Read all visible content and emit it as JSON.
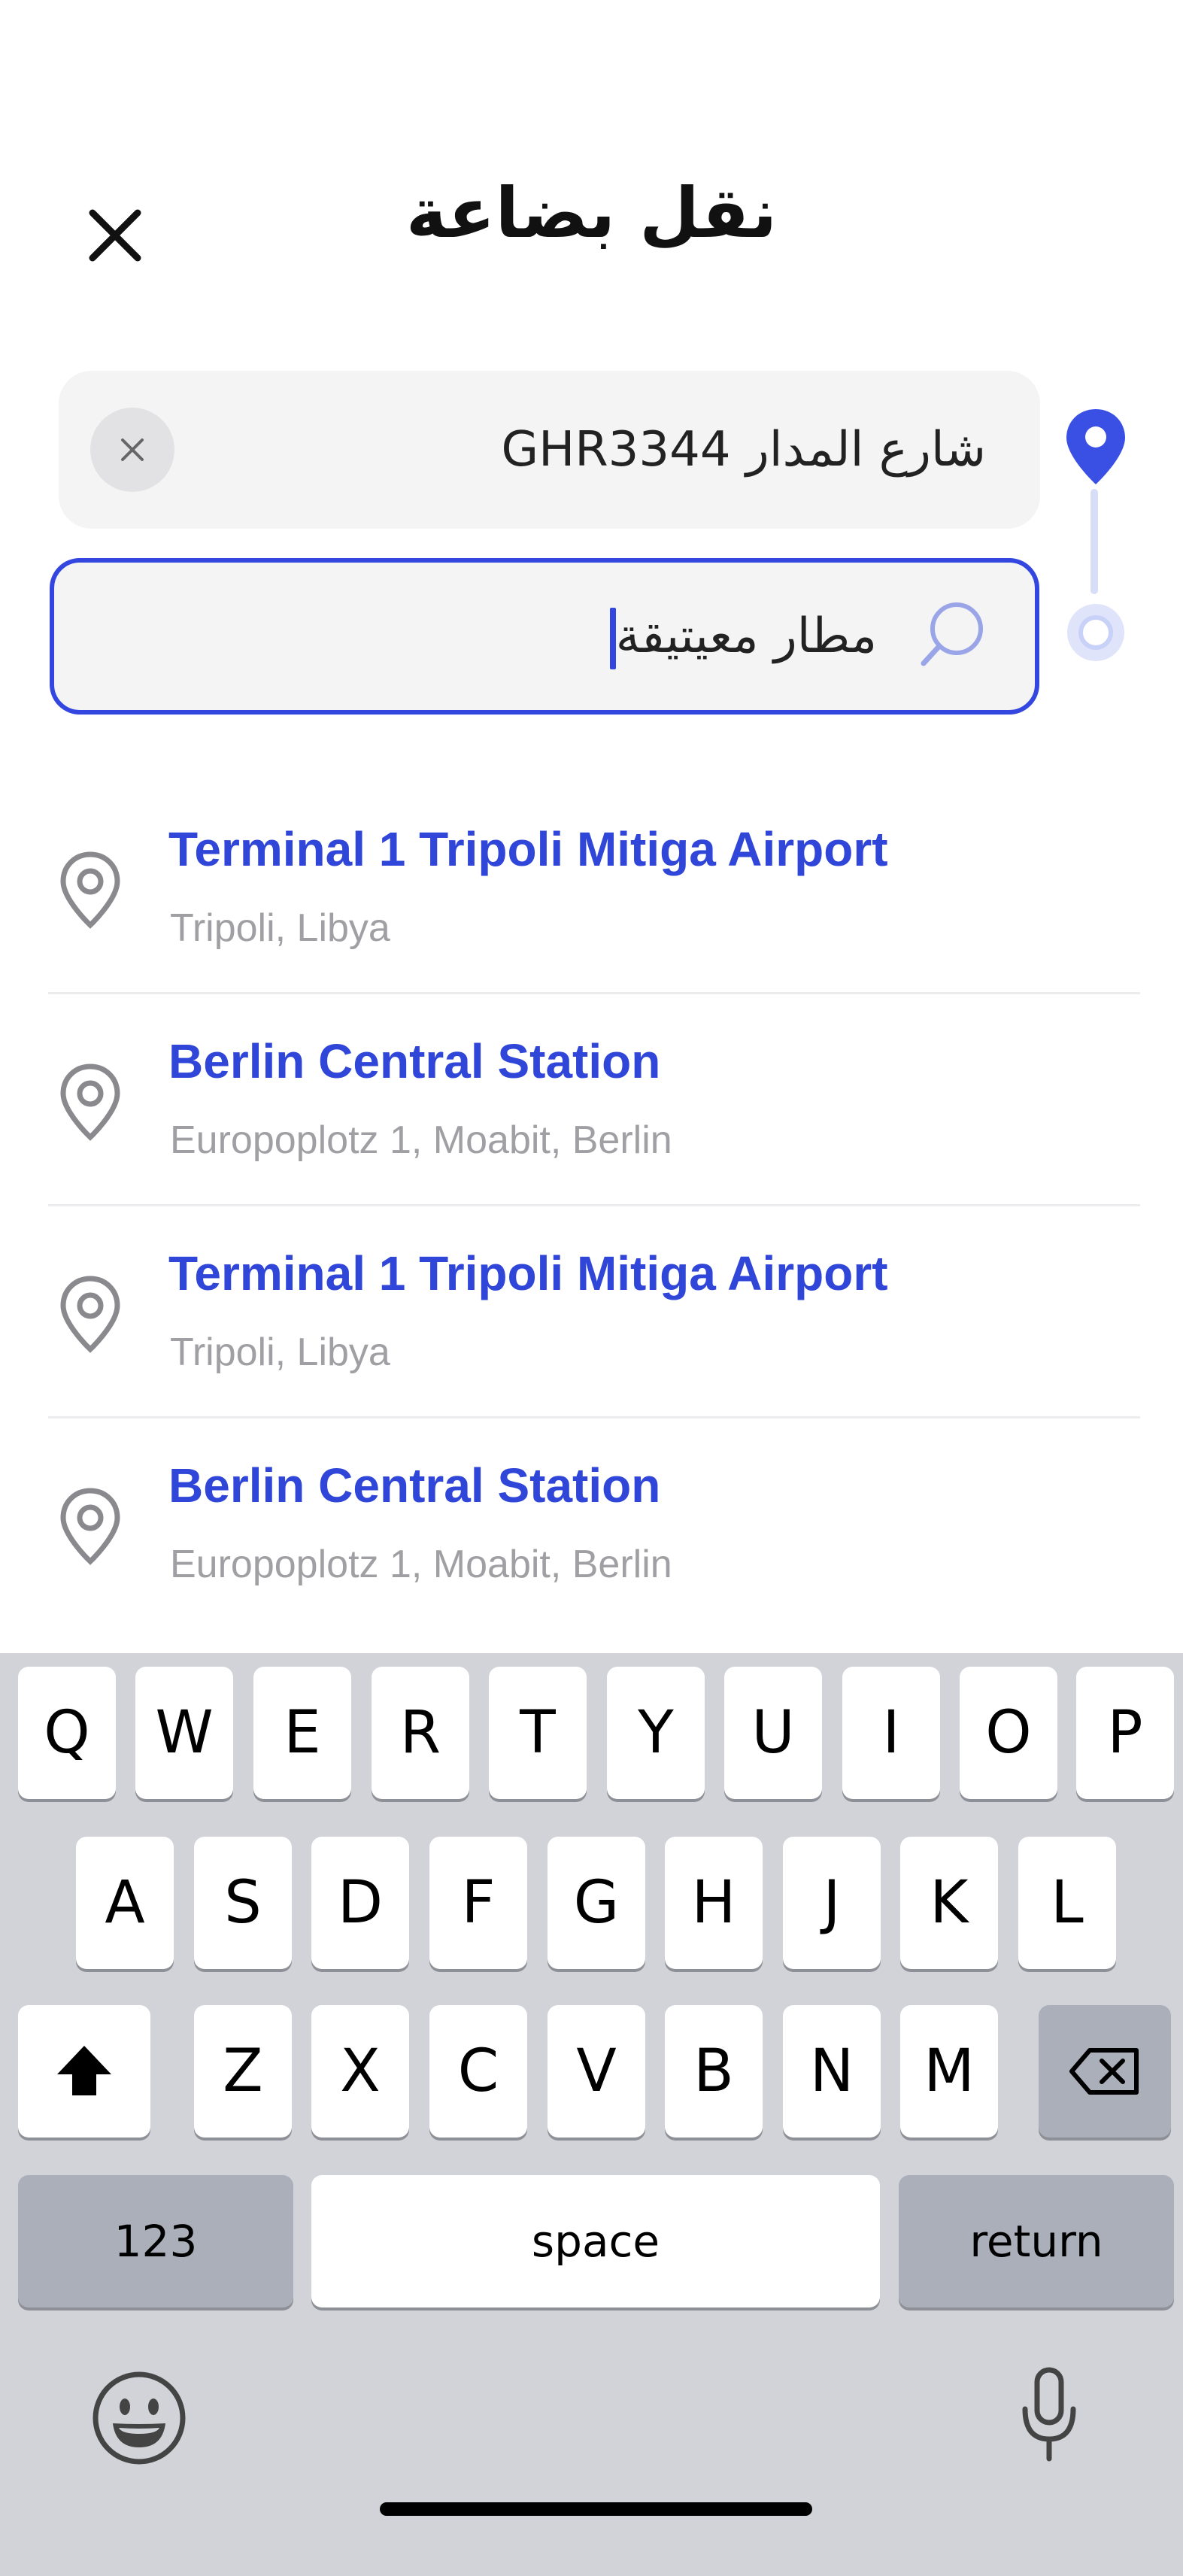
{
  "header": {
    "title": "نقل بضاعة",
    "close_icon": "close-icon"
  },
  "route": {
    "origin_value": "شارع المدار GHR3344",
    "destination_value": "مطار معيتيقة",
    "colors": {
      "accent": "#3346e0",
      "pin": "#3a4fe3",
      "route_line": "#d9def7"
    }
  },
  "results": [
    {
      "name": "Terminal 1 Tripoli Mitiga Airport",
      "address": "Tripoli, Libya"
    },
    {
      "name": "Berlin Central Station",
      "address": "Europoplotz 1, Moabit, Berlin"
    },
    {
      "name": "Terminal 1 Tripoli Mitiga Airport",
      "address": "Tripoli, Libya"
    },
    {
      "name": "Berlin Central Station",
      "address": "Europoplotz 1, Moabit, Berlin"
    }
  ],
  "keyboard": {
    "row1": [
      "Q",
      "W",
      "E",
      "R",
      "T",
      "Y",
      "U",
      "I",
      "O",
      "P"
    ],
    "row2": [
      "A",
      "S",
      "D",
      "F",
      "G",
      "H",
      "J",
      "K",
      "L"
    ],
    "row3": [
      "Z",
      "X",
      "C",
      "V",
      "B",
      "N",
      "M"
    ],
    "numbers_label": "123",
    "space_label": "space",
    "return_label": "return",
    "icons": [
      "shift-icon",
      "backspace-icon",
      "emoji-icon",
      "microphone-icon"
    ]
  }
}
